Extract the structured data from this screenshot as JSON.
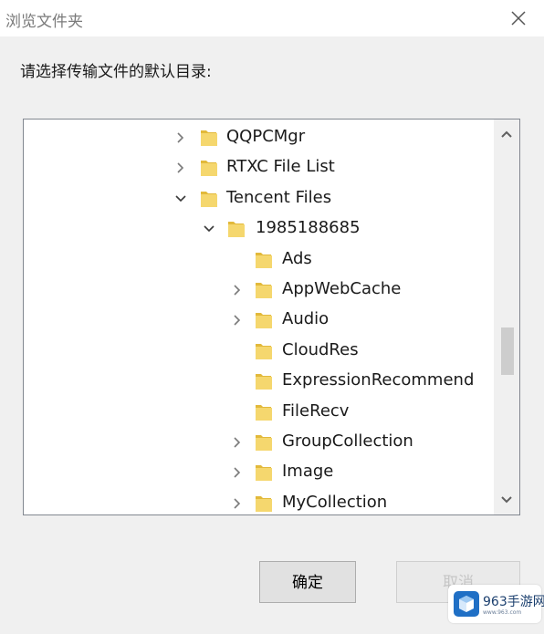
{
  "dialog": {
    "title": "浏览文件夹",
    "prompt": "请选择传输文件的默认目录:"
  },
  "tree": {
    "items": [
      {
        "label": "QQPCMgr",
        "level": 0,
        "expander": "collapsed"
      },
      {
        "label": "RTXC File List",
        "level": 0,
        "expander": "collapsed"
      },
      {
        "label": "Tencent Files",
        "level": 0,
        "expander": "expanded"
      },
      {
        "label": "1985188685",
        "level": 1,
        "expander": "expanded"
      },
      {
        "label": "Ads",
        "level": 2,
        "expander": "none"
      },
      {
        "label": "AppWebCache",
        "level": 2,
        "expander": "collapsed"
      },
      {
        "label": "Audio",
        "level": 2,
        "expander": "collapsed"
      },
      {
        "label": "CloudRes",
        "level": 2,
        "expander": "none"
      },
      {
        "label": "ExpressionRecommend",
        "level": 2,
        "expander": "none"
      },
      {
        "label": "FileRecv",
        "level": 2,
        "expander": "none"
      },
      {
        "label": "GroupCollection",
        "level": 2,
        "expander": "collapsed"
      },
      {
        "label": "Image",
        "level": 2,
        "expander": "collapsed"
      },
      {
        "label": "MyCollection",
        "level": 2,
        "expander": "collapsed"
      }
    ]
  },
  "buttons": {
    "ok_label": "确定",
    "cancel_label": "取消"
  },
  "watermark": {
    "text": "963手游网",
    "sub": "www.963.com"
  },
  "colors": {
    "folder": "#f5d76e",
    "folder_dark": "#e2b93b",
    "dialog_bg": "#f0f0f0"
  }
}
